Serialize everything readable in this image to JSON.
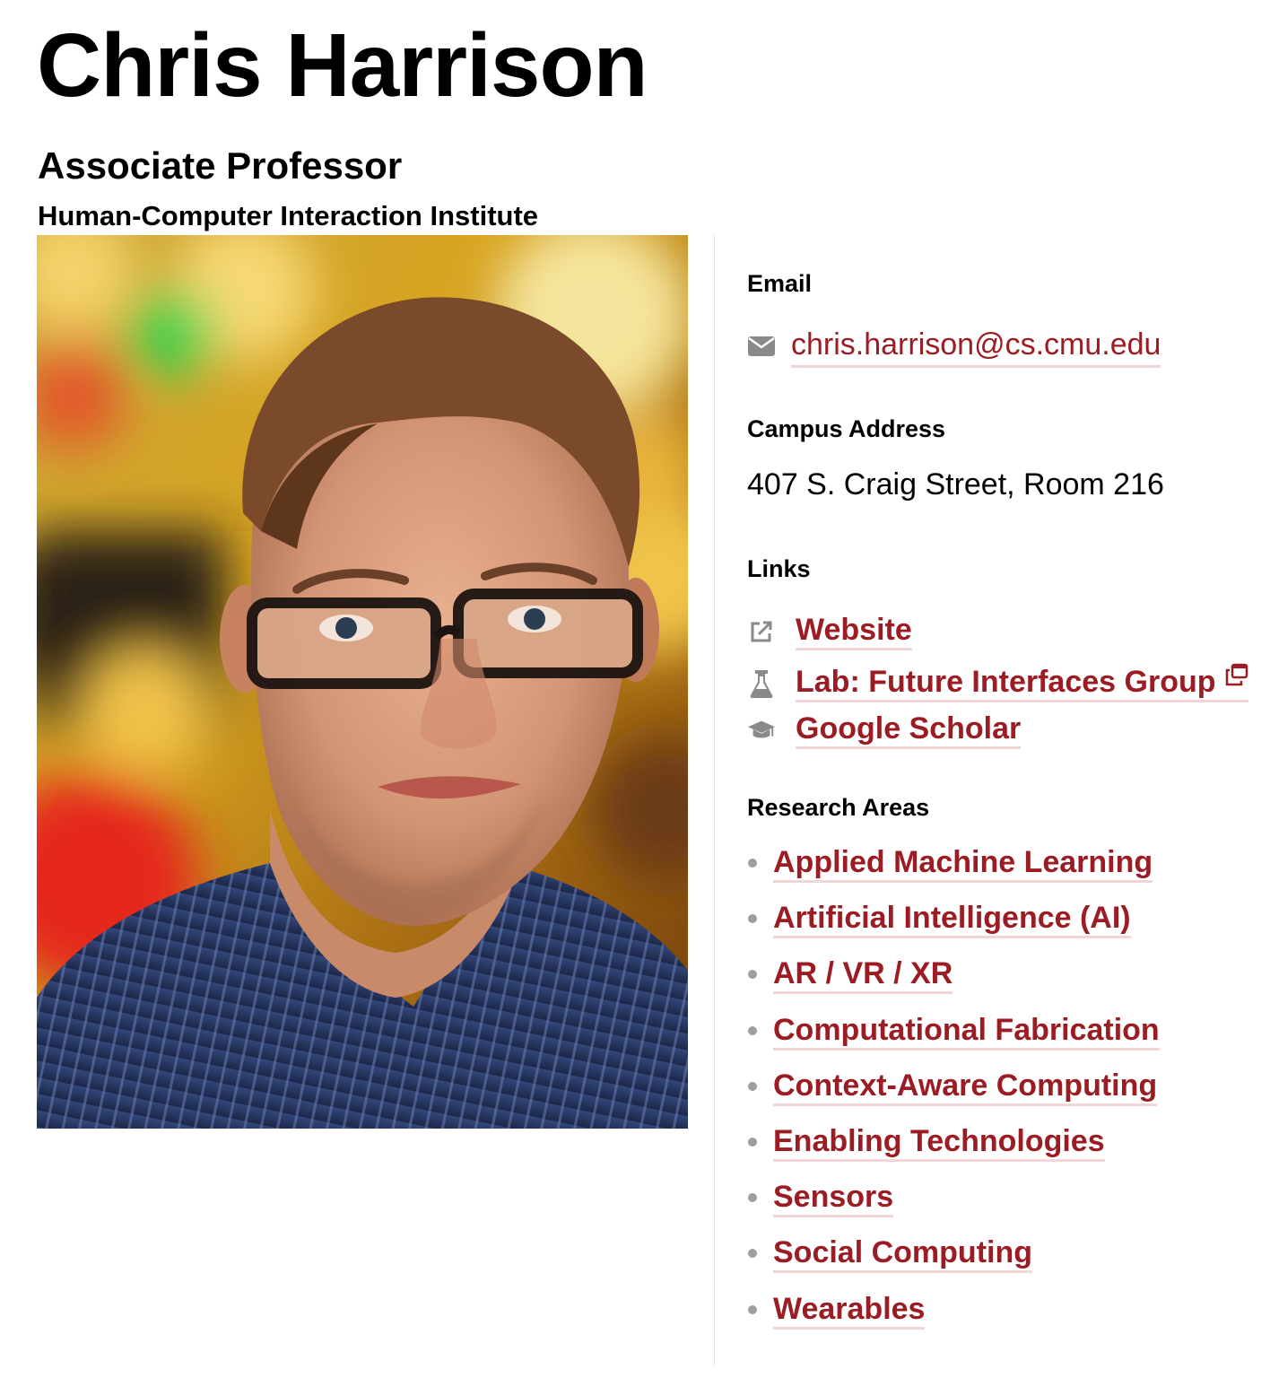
{
  "profile": {
    "name": "Chris Harrison",
    "title": "Associate Professor",
    "department": "Human-Computer Interaction Institute"
  },
  "contact": {
    "email_label": "Email",
    "email": "chris.harrison@cs.cmu.edu",
    "address_label": "Campus Address",
    "address": "407 S. Craig Street, Room 216"
  },
  "links": {
    "label": "Links",
    "items": [
      {
        "label": "Website",
        "icon": "external-link-icon"
      },
      {
        "label": "Lab: Future Interfaces Group",
        "icon": "flask-icon"
      },
      {
        "label": "Google Scholar",
        "icon": "graduation-cap-icon"
      }
    ]
  },
  "research": {
    "label": "Research Areas",
    "areas": [
      "Applied Machine Learning",
      "Artificial Intelligence (AI)",
      "AR / VR / XR",
      "Computational Fabrication",
      "Context-Aware Computing",
      "Enabling Technologies",
      "Sensors",
      "Social Computing",
      "Wearables"
    ]
  },
  "colors": {
    "link": "#9b1c23",
    "link_underline": "#f2d5d6",
    "icon": "#8a8a8a"
  }
}
